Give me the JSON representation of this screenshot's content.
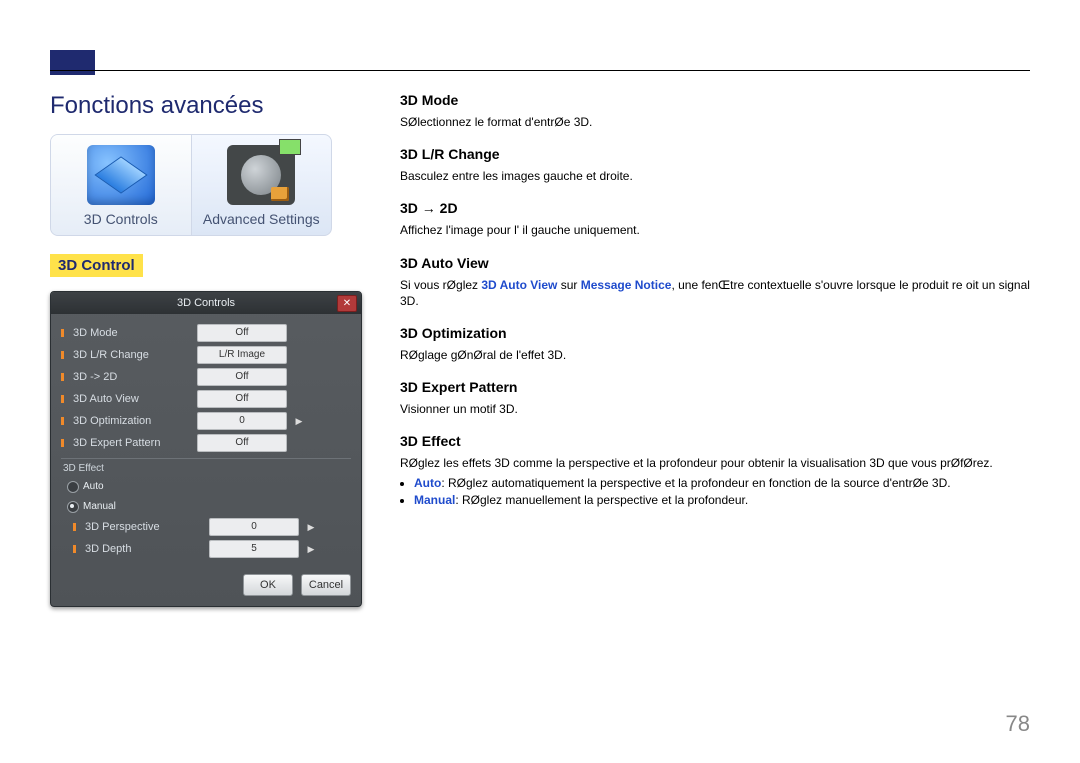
{
  "header": {
    "title": "Fonctions avancées"
  },
  "menu": {
    "tile1_label": "3D Controls",
    "tile2_label": "Advanced Settings"
  },
  "section_heading": "3D Control",
  "dialog": {
    "title": "3D Controls",
    "rows": [
      {
        "label": "3D Mode",
        "value": "Off"
      },
      {
        "label": "3D L/R Change",
        "value": "L/R Image"
      },
      {
        "label": "3D -> 2D",
        "value": "Off"
      },
      {
        "label": "3D Auto View",
        "value": "Off"
      },
      {
        "label": "3D Optimization",
        "value": "0"
      },
      {
        "label": "3D Expert Pattern",
        "value": "Off"
      }
    ],
    "effect_group_label": "3D Effect",
    "radio_auto": "Auto",
    "radio_manual": "Manual",
    "sub_rows": [
      {
        "label": "3D Perspective",
        "value": "0"
      },
      {
        "label": "3D Depth",
        "value": "5"
      }
    ],
    "ok_label": "OK",
    "cancel_label": "Cancel"
  },
  "right": {
    "items": [
      {
        "heading": "3D Mode",
        "text": "SØlectionnez le format d'entrØe 3D."
      },
      {
        "heading": "3D L/R Change",
        "text": "Basculez entre les images gauche et droite."
      },
      {
        "heading": "3D → 2D",
        "text": "Affichez l'image pour l' il gauche uniquement."
      },
      {
        "heading": "3D Auto View",
        "text_prefix": "Si vous rØglez ",
        "key1": "3D Auto View",
        "text_mid": " sur ",
        "key2": "Message Notice",
        "text_suffix": ", une fenŒtre contextuelle s'ouvre lorsque le produit re oit un signal 3D."
      },
      {
        "heading": "3D Optimization",
        "text": "RØglage gØnØral de l'effet 3D."
      },
      {
        "heading": "3D Expert Pattern",
        "text": "Visionner un motif 3D."
      },
      {
        "heading": "3D Effect",
        "text": "RØglez les effets 3D comme la perspective et la profondeur pour obtenir la visualisation 3D que vous prØfØrez.",
        "bullets": [
          {
            "key": "Auto",
            "rest": ": RØglez automatiquement la perspective et la profondeur en fonction de la source d'entrØe 3D."
          },
          {
            "key": "Manual",
            "rest": ": RØglez manuellement la perspective et la profondeur."
          }
        ]
      }
    ]
  },
  "page_number": "78"
}
